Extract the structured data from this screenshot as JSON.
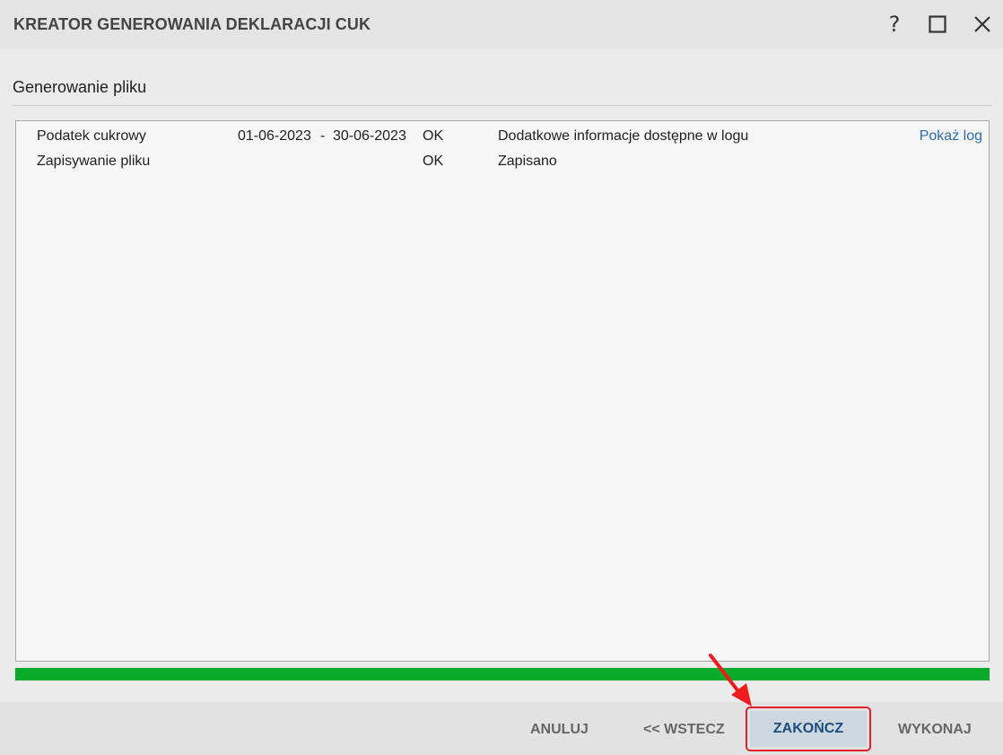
{
  "window": {
    "title": "KREATOR GENEROWANIA DEKLARACJI CUK",
    "help_label": "?"
  },
  "section": {
    "title": "Generowanie pliku"
  },
  "log": {
    "rows": [
      {
        "name": "Podatek cukrowy",
        "date_from": "01-06-2023",
        "separator": "-",
        "date_to": "30-06-2023",
        "status": "OK",
        "info": "Dodatkowe informacje dostępne w logu",
        "link": "Pokaż log"
      },
      {
        "name": "Zapisywanie pliku",
        "status": "OK",
        "info": "Zapisano"
      }
    ]
  },
  "progress": {
    "value": 1.0,
    "color": "#0aaa2a"
  },
  "footer": {
    "cancel_label": "ANULUJ",
    "back_label": "<< WSTECZ",
    "finish_label": "ZAKOŃCZ",
    "execute_label": "WYKONAJ"
  },
  "colors": {
    "highlight": "#e0202a",
    "link": "#2b6cb0"
  }
}
